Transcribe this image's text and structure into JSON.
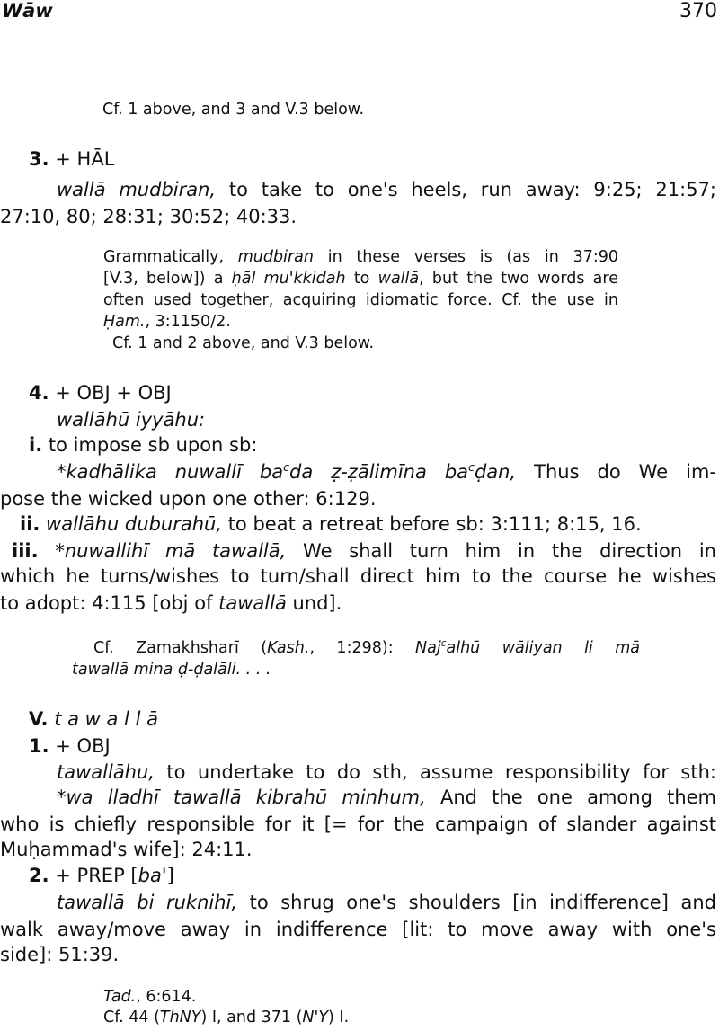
{
  "header": {
    "section": "Wāw",
    "page_number": "370"
  },
  "lines": [
    {
      "parts": [
        "Cf. 1 above, and 3 and V.3 below."
      ]
    },
    {
      "parts": [
        "3.",
        "  + HĀL"
      ]
    },
    {
      "parts": [
        "wallā mudbiran,",
        " to take to one's heels, run away: 9:25; 21:57;"
      ]
    },
    {
      "parts": [
        "27:10, 80; 28:31; 30:52; 40:33."
      ]
    },
    {
      "parts": [
        "Grammatically, ",
        "mudbiran",
        " in these verses is (as in 37:90"
      ]
    },
    {
      "parts": [
        "[V.3, below]) a ",
        "ḥāl mu'kkidah",
        " to ",
        "wallā",
        ", but the two words are"
      ]
    },
    {
      "parts": [
        "often used together, acquiring idiomatic force.  Cf. the use in"
      ]
    },
    {
      "parts": [
        "Ḥam.",
        ", 3:1150/2."
      ]
    },
    {
      "parts": [
        "Cf. 1 and 2 above, and V.3 below."
      ]
    },
    {
      "parts": [
        "4.",
        "  + OBJ + OBJ"
      ]
    },
    {
      "parts": [
        "wallāhū iyyāhu:"
      ]
    },
    {
      "parts": [
        "i.",
        " to impose sb upon sb:"
      ]
    },
    {
      "parts": [
        "*kadhālika nuwallī ba",
        "c",
        "da ẓ-ẓālimīna ba",
        "c",
        "ḍan,",
        " Thus do We im-"
      ]
    },
    {
      "parts": [
        "pose the wicked upon one other: 6:129."
      ]
    },
    {
      "parts": [
        "ii.",
        " wallāhu duburahū,",
        " to beat a retreat before sb: 3:111; 8:15, 16."
      ]
    },
    {
      "parts": [
        "iii.",
        " *nuwallihī mā tawallā,",
        " We shall turn him in the direction in"
      ]
    },
    {
      "parts": [
        "which he turns/wishes to turn/shall direct him to the course he wishes"
      ]
    },
    {
      "parts": [
        "to adopt: 4:115 [obj of ",
        "tawallā",
        " und]."
      ]
    },
    {
      "parts": [
        "Cf. Zamakhsharī (",
        "Kash.",
        ", 1:298): ",
        "Naj",
        "c",
        "alhū wāliyan li mā"
      ]
    },
    {
      "parts": [
        "tawallā mina ḍ-ḍalāli. . . ."
      ]
    },
    {
      "parts": [
        "V.",
        "  t a w a l l ā"
      ]
    },
    {
      "parts": [
        "1.",
        "  + OBJ"
      ]
    },
    {
      "parts": [
        "tawallāhu,",
        " to undertake to do sth, assume responsibility for sth:"
      ]
    },
    {
      "parts": [
        "*wa lladhī tawallā kibrahū minhum,",
        " And the one among them"
      ]
    },
    {
      "parts": [
        "who is chiefly responsible for it [= for the campaign of slander against"
      ]
    },
    {
      "parts": [
        "Muḥammad's wife]: 24:11."
      ]
    },
    {
      "parts": [
        "2.",
        "  + PREP [",
        "ba'",
        "]"
      ]
    },
    {
      "parts": [
        "tawallā bi ruknihī,",
        " to shrug one's shoulders [in indifference] and"
      ]
    },
    {
      "parts": [
        "walk away/move away in indifference [lit: to move away with one's"
      ]
    },
    {
      "parts": [
        "side]: 51:39."
      ]
    },
    {
      "parts": [
        "Tad.",
        ", 6:614."
      ]
    },
    {
      "parts": [
        "Cf. 44 (",
        "ThNY",
        ") I, and 371 (",
        "N'Y",
        ") I."
      ]
    }
  ]
}
